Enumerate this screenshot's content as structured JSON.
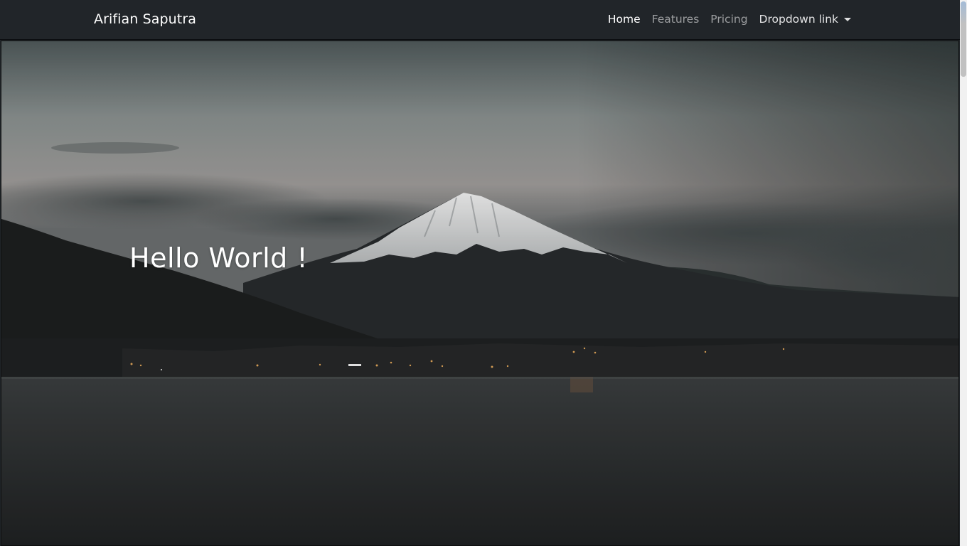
{
  "navbar": {
    "brand": "Arifian Saputra",
    "links": [
      {
        "label": "Home",
        "state": "active"
      },
      {
        "label": "Features",
        "state": "normal"
      },
      {
        "label": "Pricing",
        "state": "normal"
      },
      {
        "label": "Dropdown link",
        "state": "dropdown"
      }
    ]
  },
  "hero": {
    "title": "Hello World !",
    "background": "mountain-lake-dusk-photo"
  },
  "colors": {
    "navbar_bg": "#212529",
    "text_light": "#ffffff",
    "text_muted": "rgba(255,255,255,0.55)"
  }
}
